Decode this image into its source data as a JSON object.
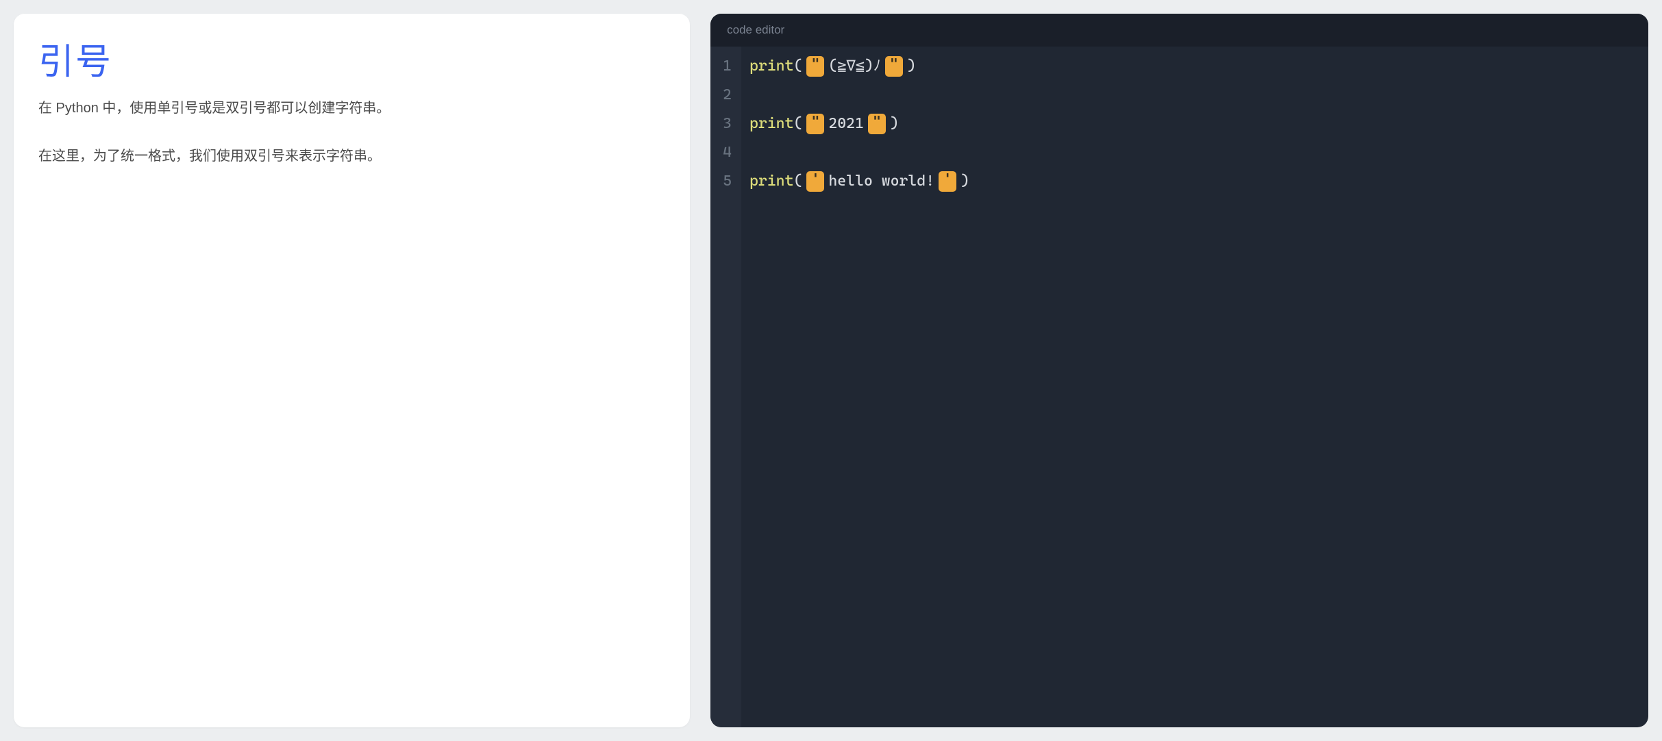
{
  "doc": {
    "title": "引号",
    "p1": "在 Python 中，使用单引号或是双引号都可以创建字符串。",
    "p2": "在这里，为了统一格式，我们使用双引号来表示字符串。"
  },
  "editor": {
    "header": "code editor",
    "gutter": [
      "1",
      "2",
      "3",
      "4",
      "5"
    ],
    "lines": [
      {
        "type": "print",
        "fn": "print",
        "open": "(",
        "q1": "\"",
        "content": "(≧∇≦)ﾉ",
        "q2": "\"",
        "close": ")"
      },
      {
        "type": "blank"
      },
      {
        "type": "print",
        "fn": "print",
        "open": "(",
        "q1": "\"",
        "content": "2021",
        "q2": "\"",
        "close": ")"
      },
      {
        "type": "blank"
      },
      {
        "type": "print",
        "fn": "print",
        "open": "(",
        "q1": "'",
        "content": "hello world!",
        "q2": "'",
        "close": ")"
      }
    ]
  }
}
